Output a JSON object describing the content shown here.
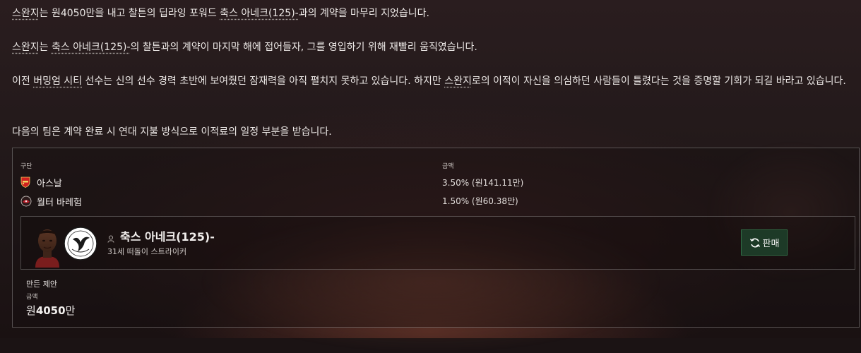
{
  "article": {
    "p1": {
      "a": "스완지",
      "b": "는 원4050만을 내고 찰튼의 딥라잉 포워드 ",
      "c": "축스 아네크(125)-",
      "d": "과의 계약을 마무리 지었습니다."
    },
    "p2": {
      "a": "스완지",
      "b": "는 ",
      "c": "축스 아네크(125)-",
      "d": "의 찰튼과의 계약이 마지막 해에 접어들자, 그를 영입하기 위해 재빨리 움직였습니다."
    },
    "p3": {
      "a": "이전 ",
      "b": "버밍엄 시티",
      "c": " 선수는 신의 선수 경력 초반에 보여줬던 잠재력을 아직 펼치지 못하고 있습니다. 하지만 ",
      "d": "스완지",
      "e": "로의 이적이 자신을 의심하던 사람들이 틀렸다는 것을 증명할 기회가 되길 바라고 있습니다."
    },
    "p4": "다음의 팀은 계약 완료 시 연대 지불 방식으로 이적료의 일정 부분을 받습니다."
  },
  "solidarity": {
    "col_club": "구단",
    "col_amount": "금액",
    "rows": [
      {
        "club": "아스날",
        "amount": "3.50% (원141.11만)",
        "crest_icon": "arsenal-crest-icon"
      },
      {
        "club": "월터 바레험",
        "amount": "1.50% (원60.38만)",
        "crest_icon": "club-crest-icon"
      }
    ]
  },
  "player": {
    "name": "축스 아네크(125)-",
    "info": "31세 떠돌이 스트라이커",
    "sell_label": "판매"
  },
  "offer": {
    "label": "만든 제안",
    "amount_label": "금액",
    "amount_prefix": "원",
    "amount_bold": "4050",
    "amount_suffix": "만"
  },
  "colors": {
    "sell_button_bg": "#1d3a27",
    "arsenal_red": "#d0201f"
  }
}
